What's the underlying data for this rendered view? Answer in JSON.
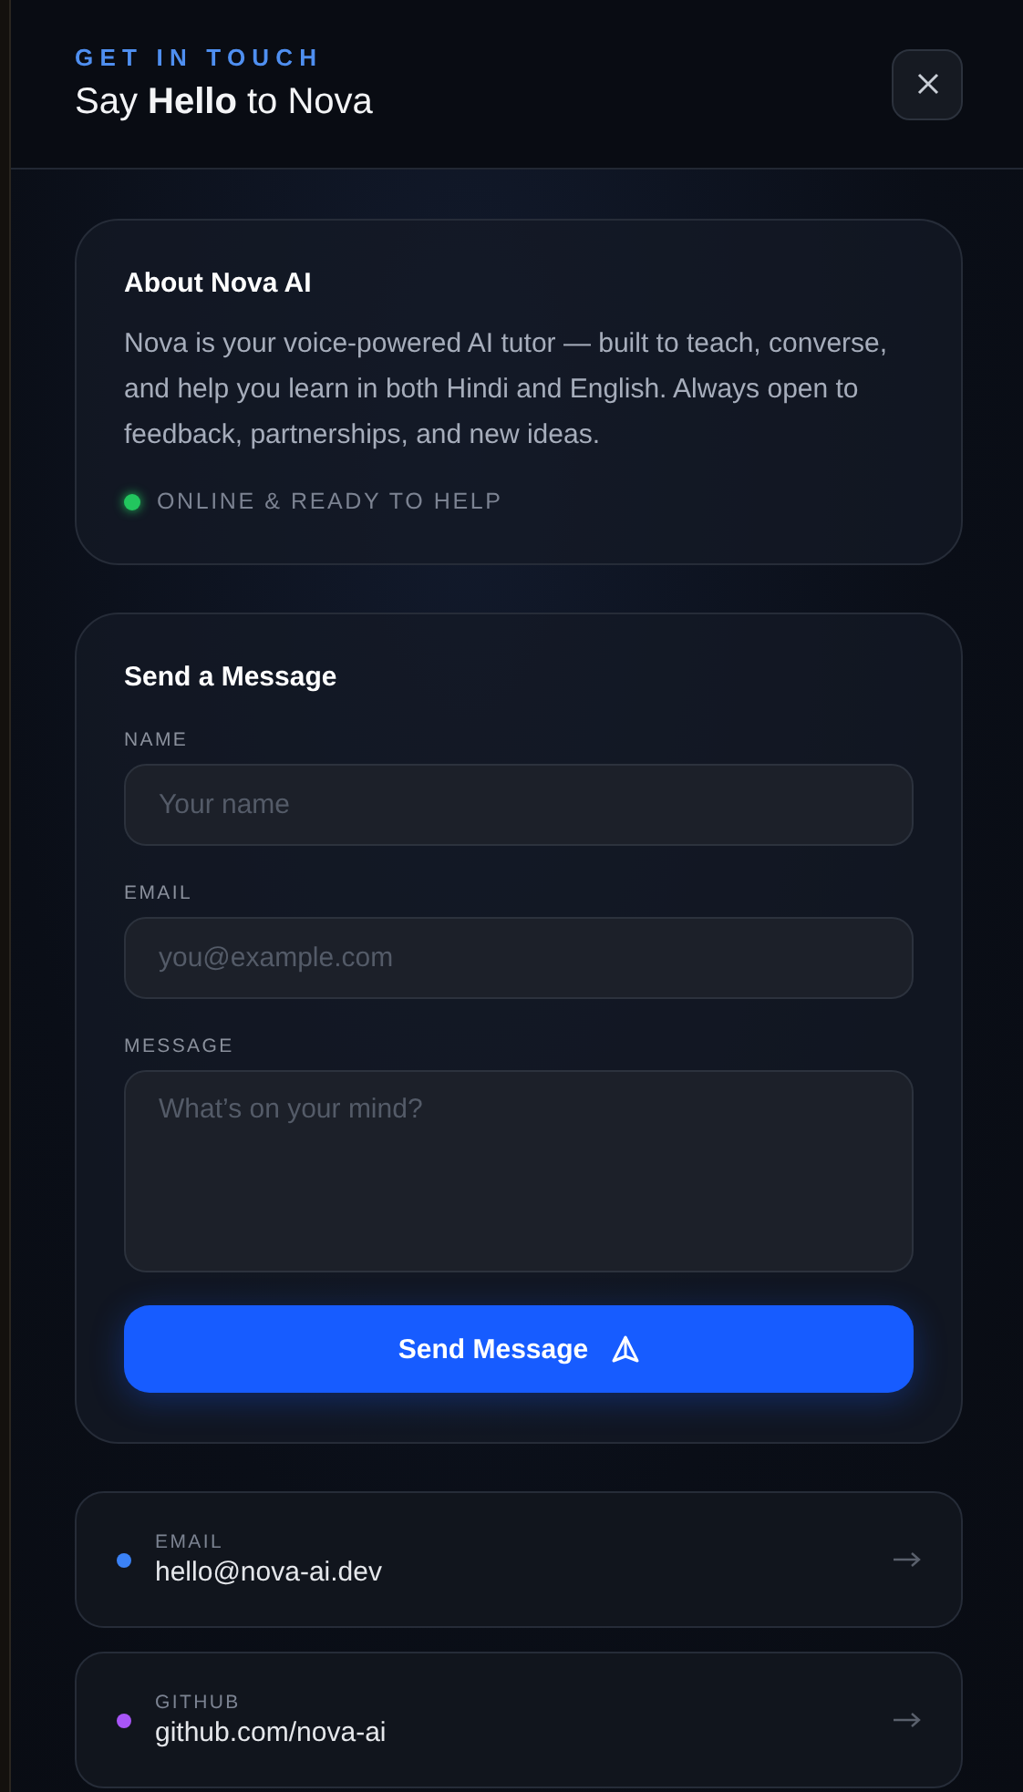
{
  "header": {
    "eyebrow": "GET IN TOUCH",
    "title": "Say **Hello** to Nova"
  },
  "about": {
    "title": "About Nova AI",
    "body": "Nova is your voice-powered AI tutor — built to teach, converse, and help you learn in both Hindi and English. Always open to feedback, partnerships, and new ideas.",
    "status": {
      "label": "ONLINE & READY TO HELP",
      "color": "#22c55e"
    }
  },
  "form": {
    "title": "Send a Message",
    "fields": [
      {
        "label": "NAME",
        "placeholder": "Your name",
        "kind": "input"
      },
      {
        "label": "EMAIL",
        "placeholder": "you@example.com",
        "kind": "input"
      },
      {
        "label": "MESSAGE",
        "placeholder": "What’s on your mind?",
        "kind": "textarea"
      }
    ],
    "submit": "Send Message"
  },
  "contacts": [
    {
      "label": "EMAIL",
      "value": "hello@nova-ai.dev",
      "color": "#3b82f6"
    },
    {
      "label": "GITHUB",
      "value": "github.com/nova-ai",
      "color": "#a855f7"
    }
  ]
}
